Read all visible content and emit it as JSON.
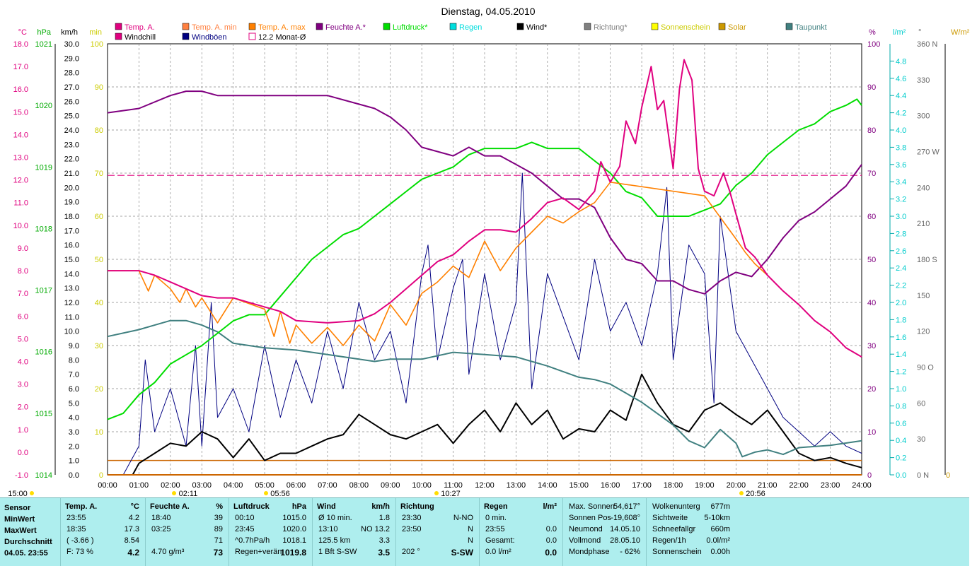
{
  "chart_data": {
    "type": "line",
    "title": "Dienstag, 04.05.2010",
    "x_range": [
      "00:00",
      "24:00"
    ],
    "x_ticks": [
      "00:00",
      "01:00",
      "02:00",
      "03:00",
      "04:00",
      "05:00",
      "06:00",
      "07:00",
      "08:00",
      "09:00",
      "10:00",
      "11:00",
      "12:00",
      "13:00",
      "14:00",
      "15:00",
      "16:00",
      "17:00",
      "18:00",
      "19:00",
      "20:00",
      "21:00",
      "22:00",
      "23:00",
      "24:00"
    ],
    "left_axes": [
      {
        "unit": "°C",
        "color": "#e0007f",
        "ylim": [
          -1,
          18
        ],
        "ticks": [
          "18.0",
          "17.0",
          "16.0",
          "15.0",
          "14.0",
          "13.0",
          "12.0",
          "11.0",
          "10.0",
          "9.0",
          "8.0",
          "7.0",
          "6.0",
          "5.0",
          "4.0",
          "3.0",
          "2.0",
          "1.0",
          "0.0",
          "-1.0"
        ]
      },
      {
        "unit": "hPa",
        "color": "#00aa00",
        "ylim": [
          1014,
          1021
        ],
        "ticks": [
          "1021",
          "1020",
          "1019",
          "1018",
          "1017",
          "1016",
          "1015",
          "1014"
        ]
      },
      {
        "unit": "km/h",
        "color": "#000000",
        "ylim": [
          0,
          30
        ],
        "ticks": [
          "30.0",
          "29.0",
          "28.0",
          "27.0",
          "26.0",
          "25.0",
          "24.0",
          "23.0",
          "22.0",
          "21.0",
          "20.0",
          "19.0",
          "18.0",
          "17.0",
          "16.0",
          "15.0",
          "14.0",
          "13.0",
          "12.0",
          "11.0",
          "10.0",
          "9.0",
          "8.0",
          "7.0",
          "6.0",
          "5.0",
          "4.0",
          "3.0",
          "2.0",
          "1.0",
          "0.0"
        ]
      },
      {
        "unit": "min",
        "color": "#cccc00",
        "ylim": [
          0,
          100
        ],
        "ticks": [
          "100",
          "90",
          "80",
          "70",
          "60",
          "50",
          "40",
          "30",
          "20",
          "10",
          "0"
        ]
      }
    ],
    "right_axes": [
      {
        "unit": "%",
        "color": "#800080",
        "ylim": [
          0,
          100
        ],
        "ticks": [
          "100",
          "90",
          "80",
          "70",
          "60",
          "50",
          "40",
          "30",
          "20",
          "10",
          "0"
        ]
      },
      {
        "unit": "l/m²",
        "color": "#00cccc",
        "ylim": [
          0,
          5
        ],
        "ticks": [
          "4.8",
          "4.6",
          "4.4",
          "4.2",
          "4.0",
          "3.8",
          "3.6",
          "3.4",
          "3.2",
          "3.0",
          "2.8",
          "2.6",
          "2.4",
          "2.2",
          "2.0",
          "1.8",
          "1.6",
          "1.4",
          "1.2",
          "1.0",
          "0.8",
          "0.6",
          "0.4",
          "0.2",
          "0.0"
        ]
      },
      {
        "unit": "°",
        "color": "#666666",
        "ylim": [
          0,
          360
        ],
        "ticks": [
          "360 N",
          "330",
          "300",
          "270 W",
          "240",
          "210",
          "180 S",
          "150",
          "120",
          "90  O",
          "60",
          "30",
          "0   N"
        ]
      },
      {
        "unit": "W/m²",
        "color": "#cc9900",
        "ticks": [
          "0"
        ]
      }
    ],
    "legend": [
      {
        "label": "Temp. A.",
        "color": "#e0007f",
        "row": 1
      },
      {
        "label": "Temp. A. min",
        "color": "#ff8040",
        "row": 1
      },
      {
        "label": "Temp. A. max",
        "color": "#ff8000",
        "row": 1
      },
      {
        "label": "Feuchte A.*",
        "color": "#800080",
        "row": 1
      },
      {
        "label": "Luftdruck*",
        "color": "#00dd00",
        "row": 1
      },
      {
        "label": "Regen",
        "color": "#00dddd",
        "row": 1
      },
      {
        "label": "Wind*",
        "color": "#000000",
        "row": 1
      },
      {
        "label": "Richtung*",
        "color": "#808080",
        "row": 1
      },
      {
        "label": "Sonnenschein",
        "color": "#ffff00",
        "row": 1
      },
      {
        "label": "Solar",
        "color": "#cc9900",
        "row": 1
      },
      {
        "label": "Taupunkt",
        "color": "#408080",
        "row": 1
      },
      {
        "label": "Windchill",
        "color": "#e0007f",
        "row": 2
      },
      {
        "label": "Windböen",
        "color": "#000080",
        "row": 2
      },
      {
        "label": "12.2 Monat-Ø",
        "color": "#e0007f",
        "row": 2
      }
    ],
    "monthly_avg_temp": 12.2,
    "sun_labels": [
      "15:00",
      "02:11",
      "05:56",
      "10:27",
      "20:56"
    ],
    "series": [
      {
        "name": "Temp. A.",
        "unit": "°C",
        "color": "#e0007f",
        "x": [
          0,
          1,
          1.5,
          2,
          2.5,
          3,
          3.5,
          4,
          5,
          5.5,
          6,
          7,
          8,
          8.5,
          9,
          10,
          10.5,
          11,
          11.5,
          12,
          12.5,
          13,
          13.5,
          14,
          14.5,
          15,
          15.5,
          15.7,
          16,
          16.3,
          16.5,
          16.8,
          17,
          17.3,
          17.5,
          17.7,
          18,
          18.2,
          18.35,
          18.6,
          18.8,
          19,
          19.3,
          19.6,
          19.8,
          20,
          20.3,
          20.6,
          21,
          21.5,
          22,
          22.5,
          23,
          23.5,
          24
        ],
        "y": [
          8.0,
          8.0,
          7.8,
          7.5,
          7.2,
          6.9,
          6.8,
          6.8,
          6.4,
          6.2,
          5.8,
          5.7,
          5.8,
          6.1,
          6.6,
          7.8,
          8.4,
          8.7,
          9.3,
          9.8,
          9.8,
          9.7,
          10.3,
          11.0,
          11.2,
          10.7,
          11.5,
          12.8,
          11.9,
          12.6,
          14.6,
          13.6,
          15.2,
          17.0,
          15.1,
          15.5,
          12.5,
          16.0,
          17.3,
          16.4,
          12.5,
          11.5,
          11.3,
          12.3,
          11.5,
          10.5,
          9.0,
          8.6,
          7.8,
          7.1,
          6.5,
          5.8,
          5.3,
          4.6,
          4.2
        ]
      },
      {
        "name": "Feuchte A.*",
        "unit": "%",
        "color": "#800080",
        "x": [
          0,
          1,
          2,
          2.5,
          3,
          3.5,
          4,
          5,
          6,
          7,
          8,
          8.5,
          9,
          9.5,
          10,
          11,
          11.5,
          12,
          12.5,
          13,
          13.5,
          14,
          14.5,
          15,
          15.5,
          16,
          16.5,
          17,
          17.5,
          18,
          18.5,
          19,
          19.5,
          20,
          20.5,
          21,
          21.5,
          22,
          22.5,
          23,
          23.5,
          24
        ],
        "y": [
          84,
          85,
          88,
          89,
          89,
          88,
          88,
          88,
          88,
          88,
          86,
          85,
          83,
          80,
          76,
          74,
          76,
          74,
          74,
          72,
          70,
          67,
          64,
          64,
          62,
          55,
          50,
          49,
          45,
          45,
          43,
          42,
          45,
          47,
          46,
          50,
          55,
          59,
          61,
          64,
          67,
          72
        ]
      },
      {
        "name": "Luftdruck*",
        "unit": "hPa",
        "color": "#00dd00",
        "x": [
          0,
          0.5,
          1,
          1.5,
          2,
          3,
          3.5,
          4,
          4.5,
          5,
          5.5,
          6,
          6.5,
          7,
          7.5,
          8,
          8.5,
          9,
          9.5,
          10,
          10.5,
          11,
          11.5,
          12,
          12.5,
          13,
          13.5,
          14,
          14.5,
          15,
          15.5,
          16,
          16.5,
          17,
          17.5,
          18,
          18.5,
          19,
          19.5,
          20,
          20.5,
          21,
          21.5,
          22,
          22.5,
          23,
          23.5,
          23.85,
          24
        ],
        "y": [
          1014.9,
          1015.0,
          1015.3,
          1015.5,
          1015.8,
          1016.1,
          1016.3,
          1016.5,
          1016.6,
          1016.6,
          1016.9,
          1017.2,
          1017.5,
          1017.7,
          1017.9,
          1018.0,
          1018.2,
          1018.4,
          1018.6,
          1018.8,
          1018.9,
          1019.0,
          1019.2,
          1019.3,
          1019.3,
          1019.3,
          1019.4,
          1019.3,
          1019.3,
          1019.3,
          1019.1,
          1018.9,
          1018.6,
          1018.5,
          1018.2,
          1018.2,
          1018.2,
          1018.3,
          1018.4,
          1018.7,
          1018.9,
          1019.2,
          1019.4,
          1019.6,
          1019.7,
          1019.9,
          1020.0,
          1020.1,
          1020.0
        ]
      },
      {
        "name": "Taupunkt",
        "unit": "°C",
        "color": "#408080",
        "x": [
          0,
          1,
          1.5,
          2,
          2.5,
          3,
          3.5,
          4,
          5,
          6,
          7,
          8,
          8.5,
          9,
          10,
          11,
          12,
          13,
          14,
          15,
          15.5,
          16,
          16.5,
          17,
          17.5,
          18,
          18.5,
          19,
          19.5,
          20,
          20.2,
          20.6,
          21,
          21.5,
          22,
          23,
          24
        ],
        "y": [
          5.1,
          5.4,
          5.6,
          5.8,
          5.8,
          5.6,
          5.3,
          4.8,
          4.6,
          4.5,
          4.3,
          4.1,
          4.0,
          4.1,
          4.1,
          4.4,
          4.3,
          4.2,
          3.8,
          3.3,
          3.2,
          3.0,
          2.6,
          2.2,
          1.7,
          1.2,
          0.5,
          0.2,
          1.0,
          0.4,
          -0.2,
          0.0,
          0.1,
          -0.1,
          0.2,
          0.3,
          0.5
        ]
      },
      {
        "name": "Wind*",
        "unit": "km/h",
        "color": "#000000",
        "x": [
          0,
          0.5,
          0.8,
          1,
          1.5,
          2,
          2.5,
          3,
          3.5,
          4,
          4.5,
          5,
          5.5,
          6,
          6.5,
          7,
          7.5,
          8,
          8.5,
          9,
          9.5,
          10,
          10.5,
          11,
          11.5,
          12,
          12.5,
          13,
          13.5,
          14,
          14.5,
          15,
          15.5,
          16,
          16.5,
          17,
          17.5,
          18,
          18.5,
          19,
          19.5,
          20,
          20.5,
          21,
          21.5,
          22,
          22.5,
          23,
          23.5,
          24
        ],
        "y": [
          0,
          0,
          0,
          0.8,
          1.5,
          2.2,
          2.0,
          3.0,
          2.5,
          1.2,
          2.5,
          1.0,
          1.5,
          1.5,
          2.0,
          2.5,
          2.8,
          4.2,
          3.5,
          2.8,
          2.5,
          3.0,
          3.5,
          2.2,
          3.5,
          4.5,
          3.0,
          5.0,
          3.5,
          4.5,
          2.5,
          3.2,
          3.0,
          4.5,
          3.8,
          7.0,
          5.0,
          3.5,
          3.0,
          4.5,
          5.0,
          4.2,
          3.5,
          4.5,
          3.0,
          1.5,
          1.0,
          1.2,
          0.8,
          0.5
        ]
      },
      {
        "name": "Windböen",
        "unit": "km/h",
        "color": "#000080",
        "x": [
          0,
          0.5,
          1,
          1.2,
          1.5,
          2,
          2.5,
          2.8,
          3,
          3.3,
          3.5,
          4,
          4.5,
          5,
          5.5,
          6,
          6.5,
          7,
          7.5,
          8,
          8.5,
          9,
          9.5,
          10,
          10.2,
          10.5,
          11,
          11.3,
          11.5,
          12,
          12.5,
          13,
          13.2,
          13.5,
          14,
          14.5,
          15,
          15.5,
          16,
          16.5,
          17,
          17.5,
          17.8,
          18,
          18.5,
          19,
          19.3,
          19.5,
          20,
          20.5,
          21,
          21.5,
          22,
          22.5,
          23,
          23.5,
          24
        ],
        "y": [
          0,
          0,
          2,
          8,
          3,
          6,
          2,
          9,
          2,
          12,
          4,
          6,
          3,
          9,
          4,
          8,
          5,
          10,
          6,
          12,
          8,
          10,
          5,
          14,
          16,
          8,
          13,
          15,
          7,
          14,
          8,
          12,
          21,
          6,
          14,
          11,
          8,
          15,
          10,
          12,
          9,
          14,
          20,
          8,
          16,
          14,
          5,
          18,
          10,
          8,
          6,
          4,
          3,
          2,
          3,
          2,
          1.5
        ]
      },
      {
        "name": "Temp. A. min",
        "unit": "°C",
        "color": "#ff8000",
        "x": [
          0,
          1,
          1.3,
          1.5,
          2,
          2.3,
          2.5,
          2.8,
          3,
          3.5,
          4,
          5,
          5.3,
          5.5,
          5.8,
          6,
          6.5,
          7,
          7.5,
          8,
          8.5,
          9,
          9.5,
          10,
          10.5,
          11,
          11.5,
          12,
          12.5,
          13,
          13.5,
          14,
          14.5,
          15,
          15.5,
          16,
          19,
          20,
          20.3,
          20.6,
          21
        ],
        "y": [
          8.0,
          8.0,
          7.1,
          7.8,
          7.2,
          6.6,
          7.2,
          6.4,
          6.8,
          5.7,
          6.8,
          6.3,
          5.1,
          6.2,
          4.8,
          5.6,
          4.8,
          5.5,
          4.7,
          5.6,
          4.9,
          6.5,
          5.6,
          7.0,
          7.5,
          8.2,
          7.7,
          9.3,
          8.0,
          9.0,
          9.7,
          10.4,
          10.1,
          10.6,
          11.0,
          11.9,
          11.3,
          9.4,
          8.8,
          8.3,
          7.8
        ]
      },
      {
        "name": "Regen",
        "unit": "l/m²",
        "color": "#00dddd",
        "x": [
          0,
          24
        ],
        "y": [
          0.0,
          0.0
        ]
      },
      {
        "name": "Solar",
        "unit": "W/m²",
        "color": "#cc6600",
        "x": [
          0,
          24
        ],
        "y": [
          0,
          0
        ]
      }
    ],
    "annotation_line": {
      "label": "12.2 Monat-Ø",
      "value": 12.2,
      "unit": "°C"
    },
    "baseline_line": {
      "label": "Solar",
      "value": 1.0,
      "unit": "km/h",
      "color": "#cc6600"
    }
  },
  "summary": {
    "sensor": {
      "header": "Sensor",
      "rows": [
        "MinWert",
        "MaxWert",
        "Durchschnitt",
        "04.05. 23:55"
      ]
    },
    "temp": {
      "header": "Temp. A.",
      "unit": "°C",
      "rows": [
        [
          "23:55",
          "4.2"
        ],
        [
          "18:35",
          "17.3"
        ],
        [
          "( -3.66 )",
          "8.54"
        ],
        [
          "F: 73 %",
          "4.2"
        ]
      ]
    },
    "feuchte": {
      "header": "Feuchte A.",
      "unit": "%",
      "rows": [
        [
          "18:40",
          "39"
        ],
        [
          "03:25",
          "89"
        ],
        [
          "",
          "71"
        ],
        [
          "4.70 g/m³",
          "73"
        ]
      ]
    },
    "luftdruck": {
      "header": "Luftdruck",
      "unit": "hPa",
      "rows": [
        [
          "00:10",
          "1015.0"
        ],
        [
          "23:45",
          "1020.0"
        ],
        [
          "^0.7hPa/h",
          "1018.1"
        ],
        [
          "Regen+verän",
          "1019.8"
        ]
      ]
    },
    "wind": {
      "header": "Wind",
      "unit": "km/h",
      "rows": [
        [
          "Ø 10 min.",
          "1.8"
        ],
        [
          "13:10",
          "NO 13.2"
        ],
        [
          "125.5 km",
          "3.3"
        ],
        [
          "1 Bft S-SW",
          "3.5"
        ]
      ]
    },
    "richtung": {
      "header": "Richtung",
      "rows": [
        [
          "23:30",
          "N-NO"
        ],
        [
          "23:50",
          "N"
        ],
        [
          "",
          "N"
        ],
        [
          "202 °",
          "S-SW"
        ]
      ]
    },
    "regen": {
      "header": "Regen",
      "unit": "l/m²",
      "rows": [
        [
          "0 min.",
          ""
        ],
        [
          "23:55",
          "0.0"
        ],
        [
          "Gesamt:",
          "0.0"
        ],
        [
          "0.0 l/m²",
          "0.0"
        ]
      ]
    },
    "sonne": {
      "rows": [
        [
          "Max. Sonnen",
          "54,617°"
        ],
        [
          "Sonnen Pos",
          "-19,608°"
        ],
        [
          "Neumond",
          "14.05.10"
        ],
        [
          "Vollmond",
          "28.05.10"
        ],
        [
          "Mondphase",
          "- 62%"
        ]
      ]
    },
    "wolken": {
      "rows": [
        [
          "Wolkenunterg",
          "677m"
        ],
        [
          "Sichtweite",
          "5-10km"
        ],
        [
          "Schneefallgr",
          "660m"
        ],
        [
          "Regen/1h",
          "0.0l/m²"
        ],
        [
          "Sonnenschein",
          "0.00h"
        ]
      ]
    }
  }
}
